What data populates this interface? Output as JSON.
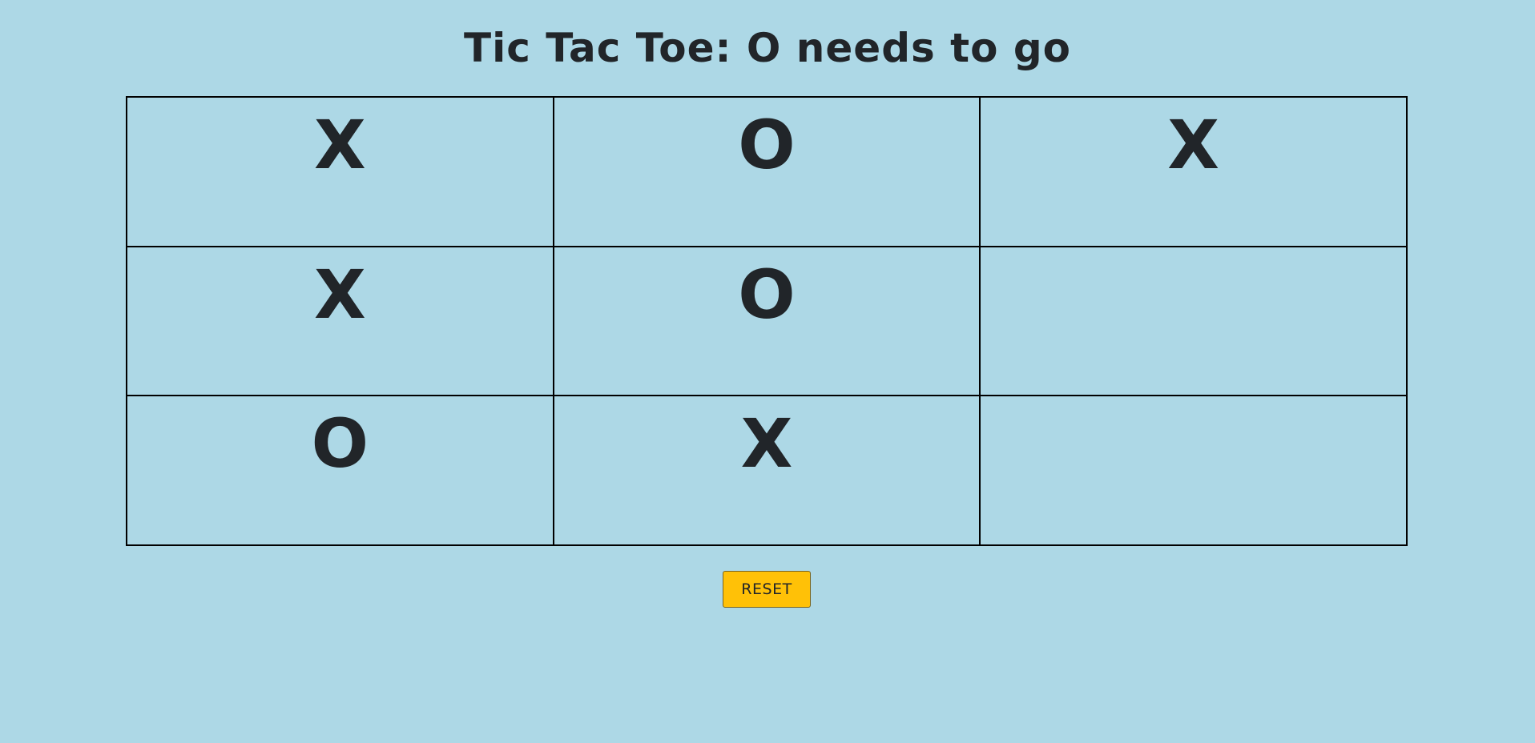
{
  "title": "Tic Tac Toe: O needs to go",
  "board": {
    "cells": [
      "X",
      "O",
      "X",
      "X",
      "O",
      "",
      "O",
      "X",
      ""
    ]
  },
  "reset_label": "RESET",
  "colors": {
    "background": "#add8e6",
    "text": "#212529",
    "grid_line": "#000000",
    "reset_button": "#ffc107"
  }
}
